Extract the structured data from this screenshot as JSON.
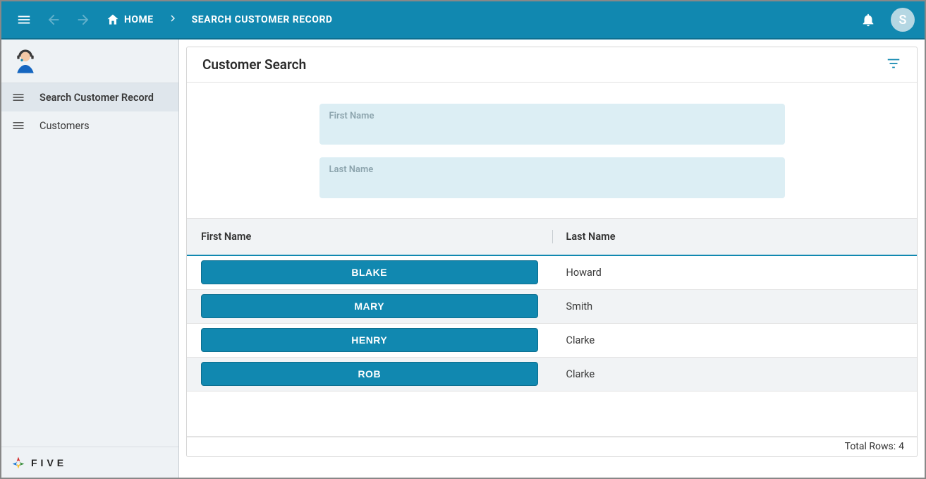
{
  "colors": {
    "accent": "#1188b0"
  },
  "header": {
    "home_label": "HOME",
    "page_label": "SEARCH CUSTOMER RECORD",
    "user_initial": "S"
  },
  "sidebar": {
    "items": [
      {
        "label": "Search Customer Record",
        "active": true
      },
      {
        "label": "Customers",
        "active": false
      }
    ],
    "brand_name": "FIVE"
  },
  "card": {
    "title": "Customer Search"
  },
  "form": {
    "first_name_label": "First Name",
    "first_name_value": "",
    "last_name_label": "Last Name",
    "last_name_value": ""
  },
  "table": {
    "columns": [
      "First Name",
      "Last Name"
    ],
    "rows": [
      {
        "first": "BLAKE",
        "last": "Howard"
      },
      {
        "first": "MARY",
        "last": "Smith"
      },
      {
        "first": "HENRY",
        "last": "Clarke"
      },
      {
        "first": "ROB",
        "last": "Clarke"
      }
    ],
    "footer_label": "Total Rows:",
    "total": 4
  }
}
